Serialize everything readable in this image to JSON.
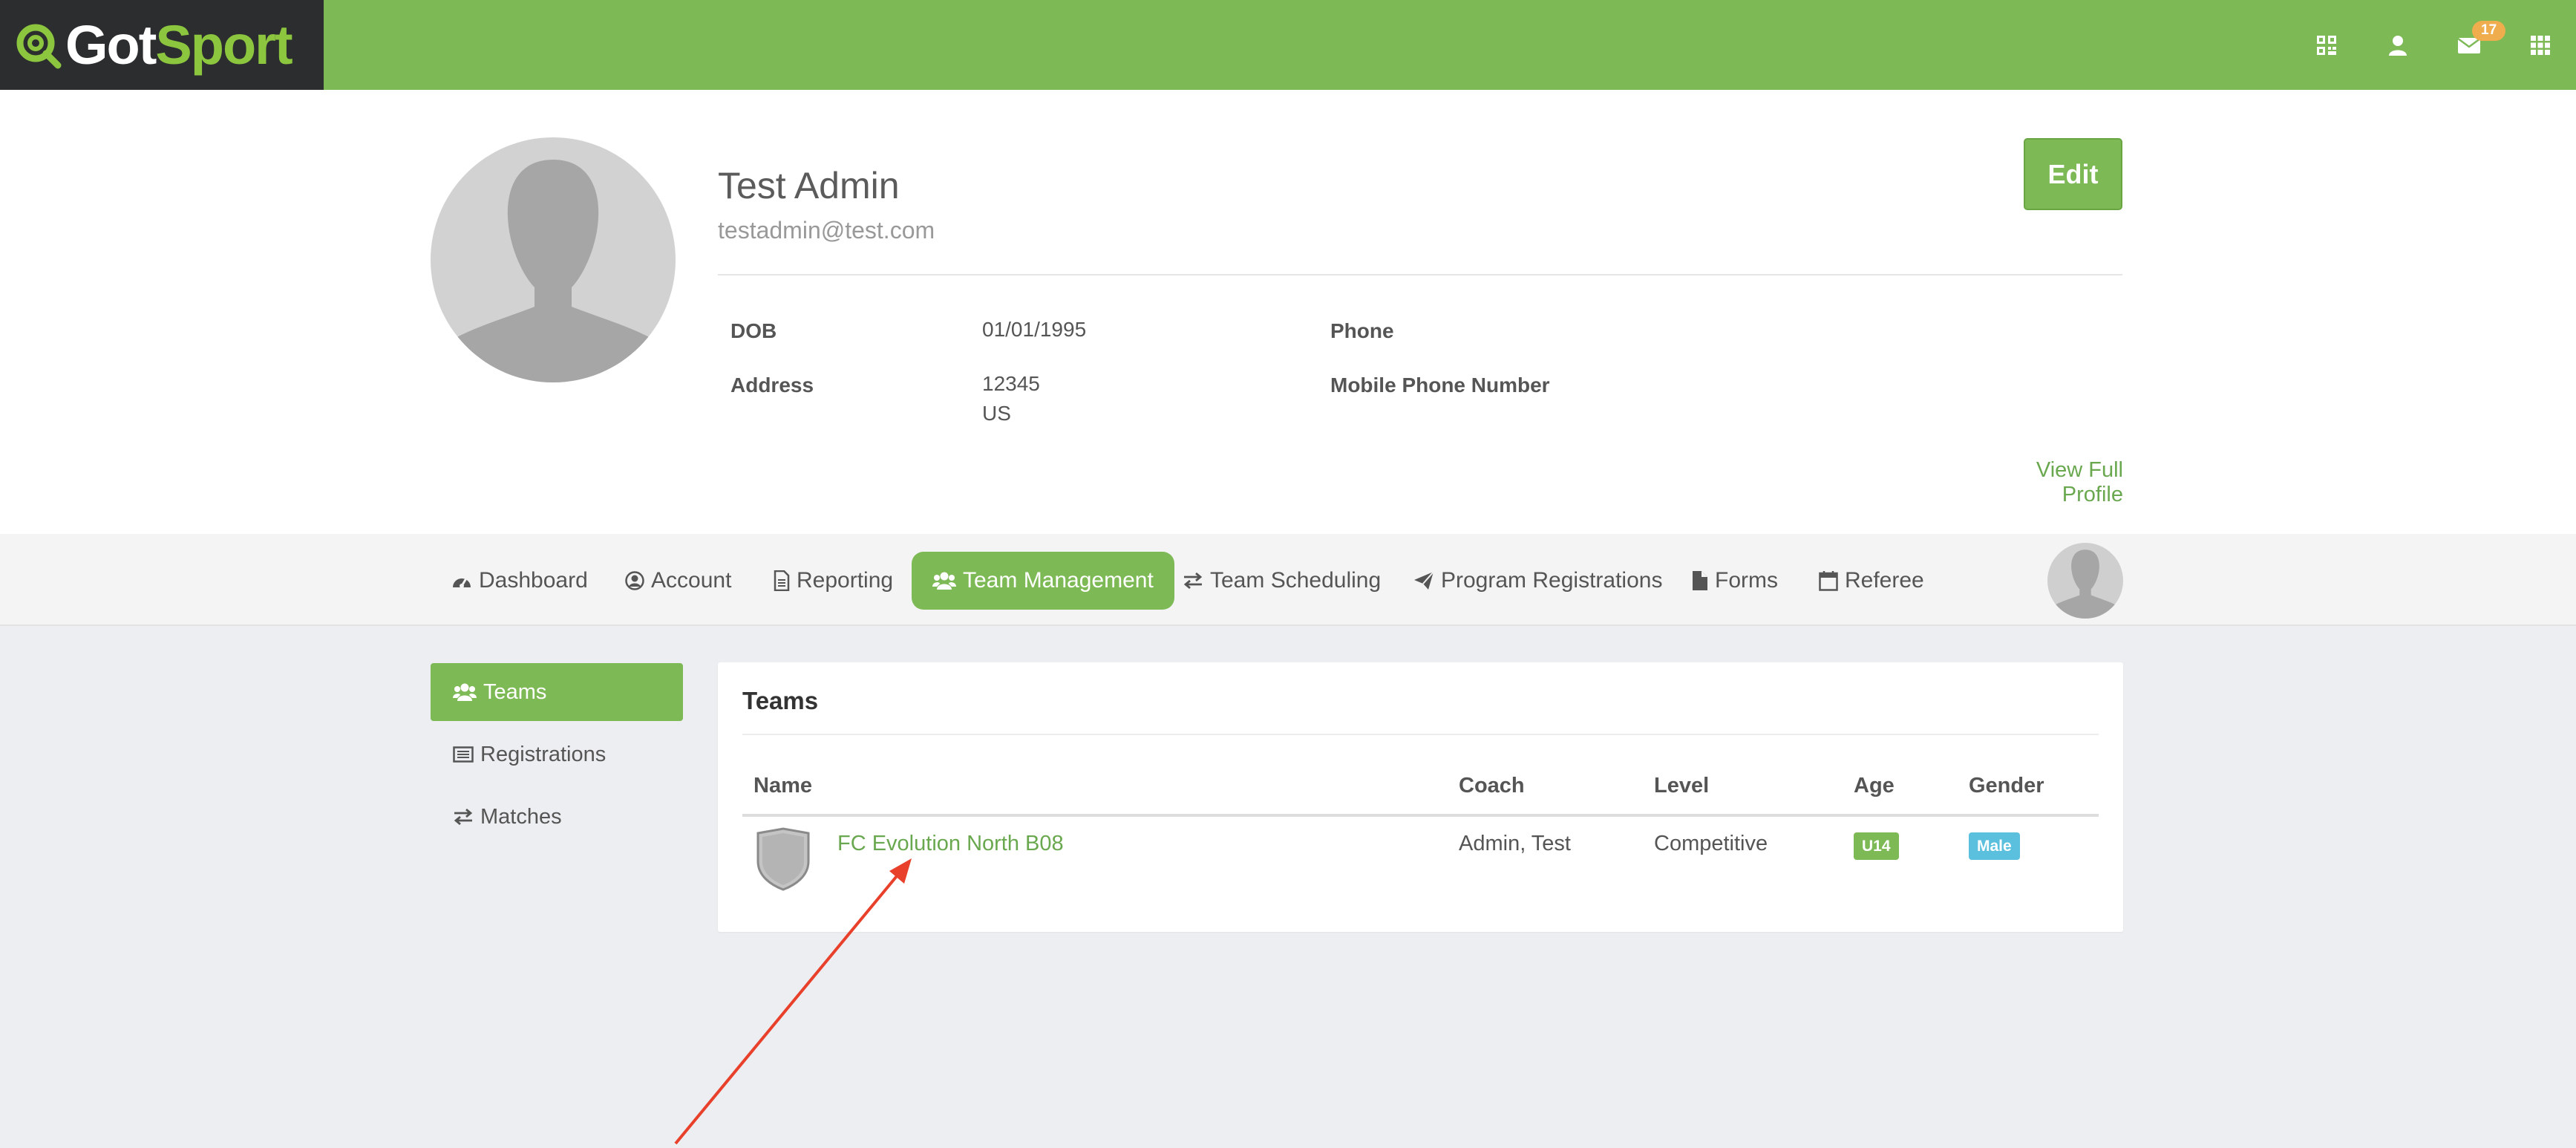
{
  "brand": {
    "got": "Got",
    "sport": "Sport"
  },
  "topbar": {
    "message_count": "17"
  },
  "profile": {
    "name": "Test Admin",
    "email": "testadmin@test.com",
    "edit_label": "Edit",
    "dob_label": "DOB",
    "dob_value": "01/01/1995",
    "address_label": "Address",
    "address_line1": "12345",
    "address_line2": "US",
    "phone_label": "Phone",
    "mobile_label": "Mobile Phone Number",
    "view_full_label": "View Full Profile"
  },
  "nav": {
    "items": [
      {
        "label": "Dashboard",
        "icon": "dashboard-icon"
      },
      {
        "label": "Account",
        "icon": "user-circle-icon"
      },
      {
        "label": "Reporting",
        "icon": "document-icon"
      },
      {
        "label": "Team Management",
        "icon": "users-icon",
        "active": true
      },
      {
        "label": "Team Scheduling",
        "icon": "exchange-icon"
      },
      {
        "label": "Program Registrations",
        "icon": "paper-plane-icon"
      },
      {
        "label": "Forms",
        "icon": "file-icon"
      },
      {
        "label": "Referee",
        "icon": "calendar-icon"
      }
    ]
  },
  "sidebar": {
    "items": [
      {
        "label": "Teams",
        "icon": "users-icon",
        "active": true
      },
      {
        "label": "Registrations",
        "icon": "list-icon"
      },
      {
        "label": "Matches",
        "icon": "exchange-icon"
      }
    ]
  },
  "teams": {
    "title": "Teams",
    "columns": [
      "Name",
      "Coach",
      "Level",
      "Age",
      "Gender"
    ],
    "rows": [
      {
        "name": "FC Evolution North B08",
        "coach": "Admin, Test",
        "level": "Competitive",
        "age": "U14",
        "gender": "Male"
      }
    ]
  },
  "colors": {
    "brand_green": "#7db955",
    "link_green": "#6aa84f",
    "badge_orange": "#f0ad4e",
    "label_blue": "#5bc0de",
    "annotation_red": "#e8402a"
  }
}
